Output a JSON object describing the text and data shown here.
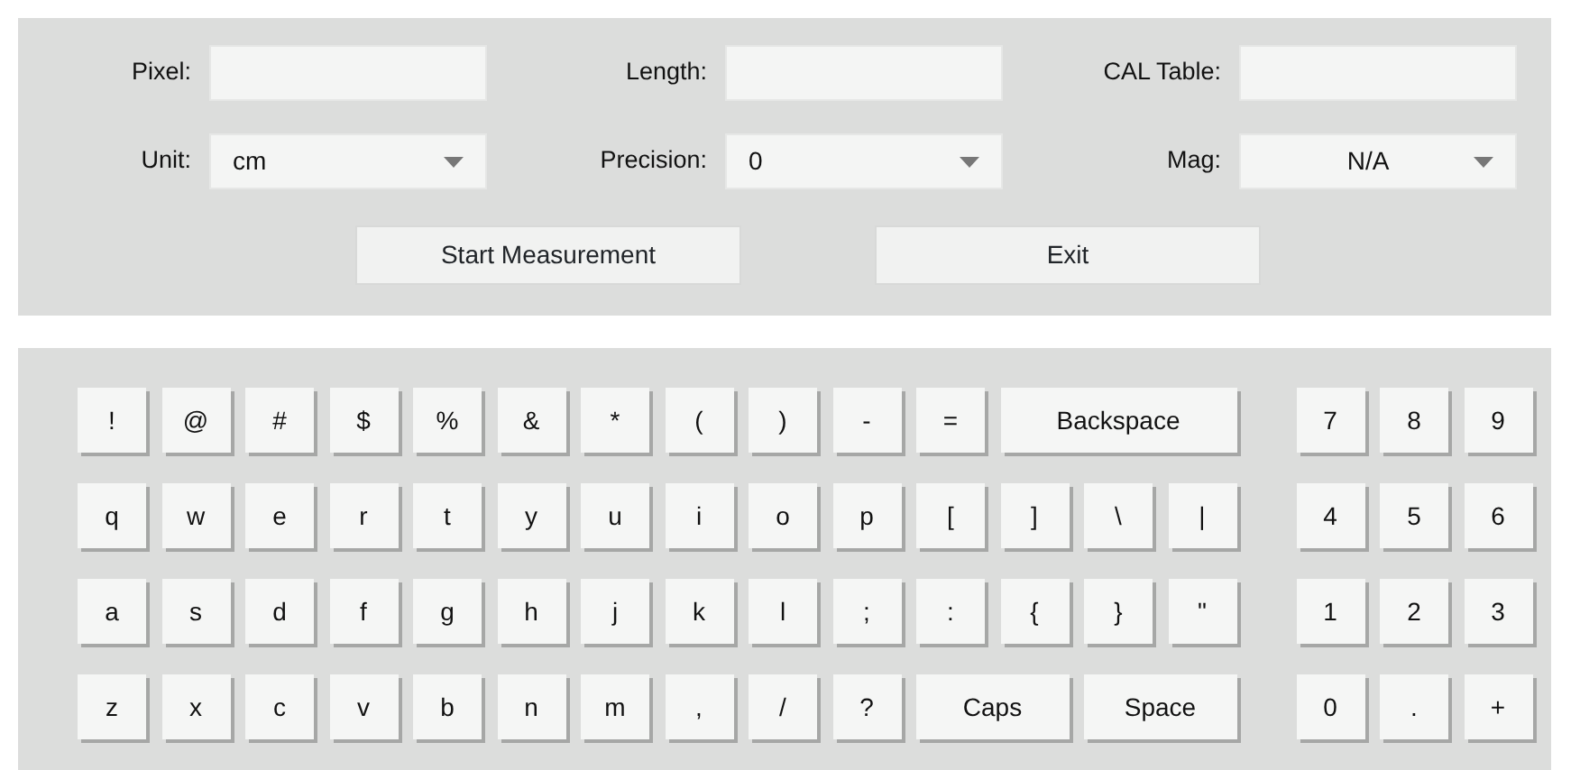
{
  "form": {
    "fields": [
      {
        "label": "Pixel:",
        "kind": "text"
      },
      {
        "label": "Length:",
        "kind": "text"
      },
      {
        "label": "CAL Table:",
        "kind": "text"
      },
      {
        "label": "Unit:",
        "kind": "select",
        "value": "cm",
        "centered": false
      },
      {
        "label": "Precision:",
        "kind": "select",
        "value": "0",
        "centered": false
      },
      {
        "label": "Mag:",
        "kind": "select",
        "value": "N/A",
        "centered": true
      }
    ],
    "buttons": [
      "Start Measurement",
      "Exit"
    ]
  },
  "keyboard": {
    "main_rows": [
      [
        {
          "label": "!",
          "kind": "char"
        },
        {
          "label": "@",
          "kind": "char"
        },
        {
          "label": "#",
          "kind": "char"
        },
        {
          "label": "$",
          "kind": "char"
        },
        {
          "label": "%",
          "kind": "char"
        },
        {
          "label": "&",
          "kind": "char"
        },
        {
          "label": "*",
          "kind": "char"
        },
        {
          "label": "(",
          "kind": "char"
        },
        {
          "label": ")",
          "kind": "char"
        },
        {
          "label": "-",
          "kind": "char"
        },
        {
          "label": "=",
          "kind": "char"
        },
        {
          "label": "Backspace",
          "kind": "triple"
        }
      ],
      [
        {
          "label": "q",
          "kind": "char"
        },
        {
          "label": "w",
          "kind": "char"
        },
        {
          "label": "e",
          "kind": "char"
        },
        {
          "label": "r",
          "kind": "char"
        },
        {
          "label": "t",
          "kind": "char"
        },
        {
          "label": "y",
          "kind": "char"
        },
        {
          "label": "u",
          "kind": "char"
        },
        {
          "label": "i",
          "kind": "char"
        },
        {
          "label": "o",
          "kind": "char"
        },
        {
          "label": "p",
          "kind": "char"
        },
        {
          "label": "[",
          "kind": "char"
        },
        {
          "label": "]",
          "kind": "char"
        },
        {
          "label": "\\",
          "kind": "char"
        },
        {
          "label": "|",
          "kind": "char"
        }
      ],
      [
        {
          "label": "a",
          "kind": "char"
        },
        {
          "label": "s",
          "kind": "char"
        },
        {
          "label": "d",
          "kind": "char"
        },
        {
          "label": "f",
          "kind": "char"
        },
        {
          "label": "g",
          "kind": "char"
        },
        {
          "label": "h",
          "kind": "char"
        },
        {
          "label": "j",
          "kind": "char"
        },
        {
          "label": "k",
          "kind": "char"
        },
        {
          "label": "l",
          "kind": "char"
        },
        {
          "label": ";",
          "kind": "char"
        },
        {
          "label": ":",
          "kind": "char"
        },
        {
          "label": "{",
          "kind": "char"
        },
        {
          "label": "}",
          "kind": "char"
        },
        {
          "label": "\"",
          "kind": "char"
        }
      ],
      [
        {
          "label": "z",
          "kind": "char"
        },
        {
          "label": "x",
          "kind": "char"
        },
        {
          "label": "c",
          "kind": "char"
        },
        {
          "label": "v",
          "kind": "char"
        },
        {
          "label": "b",
          "kind": "char"
        },
        {
          "label": "n",
          "kind": "char"
        },
        {
          "label": "m",
          "kind": "char"
        },
        {
          "label": ",",
          "kind": "char"
        },
        {
          "label": "/",
          "kind": "char"
        },
        {
          "label": "?",
          "kind": "char"
        },
        {
          "label": "Caps",
          "kind": "double"
        },
        {
          "label": "Space",
          "kind": "double"
        }
      ]
    ],
    "numpad_rows": [
      [
        {
          "label": "7",
          "kind": "char"
        },
        {
          "label": "8",
          "kind": "char"
        },
        {
          "label": "9",
          "kind": "char"
        }
      ],
      [
        {
          "label": "4",
          "kind": "char"
        },
        {
          "label": "5",
          "kind": "char"
        },
        {
          "label": "6",
          "kind": "char"
        }
      ],
      [
        {
          "label": "1",
          "kind": "char"
        },
        {
          "label": "2",
          "kind": "char"
        },
        {
          "label": "3",
          "kind": "char"
        }
      ],
      [
        {
          "label": "0",
          "kind": "char"
        },
        {
          "label": ".",
          "kind": "char"
        },
        {
          "label": "+",
          "kind": "char"
        }
      ]
    ]
  }
}
